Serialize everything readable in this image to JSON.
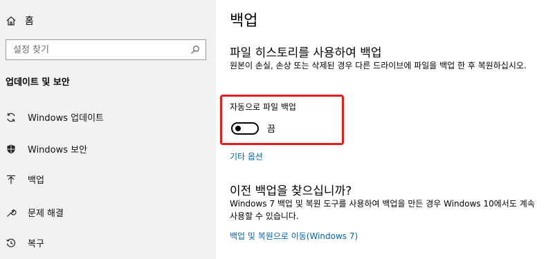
{
  "sidebar": {
    "home_label": "홈",
    "search_placeholder": "설정 찾기",
    "section_title": "업데이트 및 보안",
    "items": [
      {
        "label": "Windows 업데이트",
        "icon": "sync-icon"
      },
      {
        "label": "Windows 보안",
        "icon": "shield-icon"
      },
      {
        "label": "백업",
        "icon": "backup-arrow-icon"
      },
      {
        "label": "문제 해결",
        "icon": "wrench-icon"
      },
      {
        "label": "복구",
        "icon": "recovery-clock-icon"
      }
    ]
  },
  "main": {
    "title": "백업",
    "file_history": {
      "heading": "파일 히스토리를 사용하여 백업",
      "description": "원본이 손실, 손상 또는 삭제된 경우 다른 드라이브에 파일을 백업 한 후 복원하십시오.",
      "toggle_label": "자동으로 파일 백업",
      "toggle_state": "끔",
      "more_options": "기타 옵션"
    },
    "older_backup": {
      "heading": "이전 백업을 찾으십니까?",
      "description": "Windows 7 백업 및 복원 도구를 사용하여 백업을 만든 경우 Windows 10에서도 계속 사용할 수 있습니다.",
      "link": "백업 및 복원으로 이동(Windows 7)"
    }
  },
  "colors": {
    "sidebar_bg": "#f2f2f2",
    "link": "#0063b1",
    "highlight_box": "#e31b1b"
  }
}
